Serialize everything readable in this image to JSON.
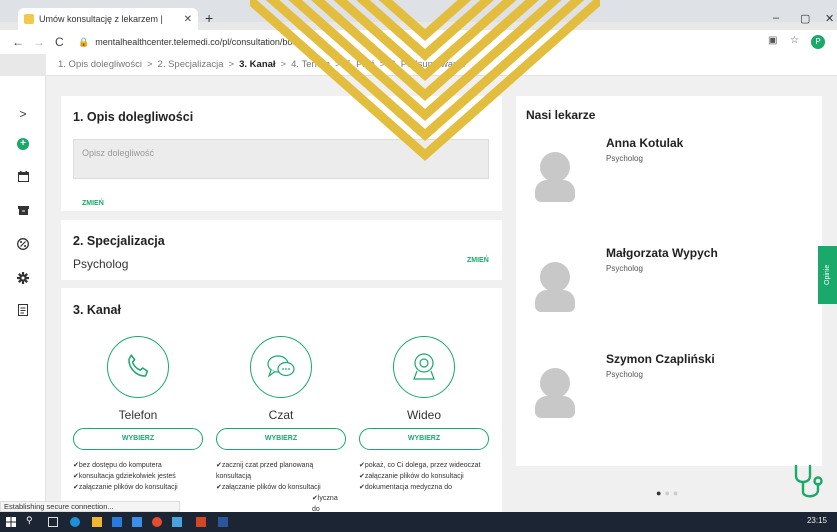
{
  "browser": {
    "tab_title": "Umów konsultację z lekarzem |",
    "tab_close": "✕",
    "new_tab": "+",
    "url": "mentalhealthcenter.telemedi.co/pl/consultation/book",
    "nav_back": "←",
    "nav_forward": "→",
    "nav_reload": "C",
    "profile_initial": "P",
    "minimize": "–",
    "maximize": "▢",
    "close_window": "✕"
  },
  "breadcrumb": {
    "steps": [
      "1. Opis dolegliwości",
      "2. Specjalizacja",
      "3. Kanał",
      "4. Termin",
      "5. Płać",
      "6. Podsumowanie"
    ],
    "separator": ">"
  },
  "sidebar": {
    "items": [
      {
        "icon": "chevron-right-icon",
        "glyph": ">"
      },
      {
        "icon": "add-circle-icon",
        "glyph": "+"
      },
      {
        "icon": "calendar-icon",
        "glyph": ""
      },
      {
        "icon": "archive-icon",
        "glyph": ""
      },
      {
        "icon": "percent-icon",
        "glyph": "%"
      },
      {
        "icon": "gear-icon",
        "glyph": ""
      },
      {
        "icon": "document-icon",
        "glyph": ""
      }
    ]
  },
  "section1": {
    "title": "1. Opis dolegliwości",
    "placeholder": "Opisz dolegliwość",
    "change": "ZMIEŃ"
  },
  "section2": {
    "title": "2. Specjalizacja",
    "value": "Psycholog",
    "change": "ZMIEŃ"
  },
  "section3": {
    "title": "3. Kanał",
    "channels": [
      {
        "name": "Telefon",
        "button": "WYBIERZ",
        "features": [
          "bez dostępu do komputera",
          "konsultacja gdziekolwiek jesteś",
          "załączanie plików do konsultacji"
        ]
      },
      {
        "name": "Czat",
        "button": "WYBIERZ",
        "features": [
          "zacznij czat przed planowaną konsultacją",
          "załączanie plików do konsultacji",
          "lyczna do"
        ]
      },
      {
        "name": "Wideo",
        "button": "WYBIERZ",
        "features": [
          "pokaż, co Ci dolega, przez wideoczat",
          "załączanie plików do konsultacji",
          "dokumentacja medyczna do"
        ]
      }
    ]
  },
  "doctors": {
    "title": "Nasi lekarze",
    "list": [
      {
        "name": "Anna Kotulak",
        "role": "Psycholog"
      },
      {
        "name": "Małgorzata Wypych",
        "role": "Psycholog"
      },
      {
        "name": "Szymon Czapliński",
        "role": "Psycholog"
      }
    ],
    "carousel_dots": 3,
    "carousel_active": 1
  },
  "feedback_tab": "Opinie",
  "status_text": "Establishing secure connection...",
  "taskbar": {
    "clock": "23:15"
  },
  "colors": {
    "accent": "#1aa86b",
    "deco": "#e3bd3e"
  }
}
